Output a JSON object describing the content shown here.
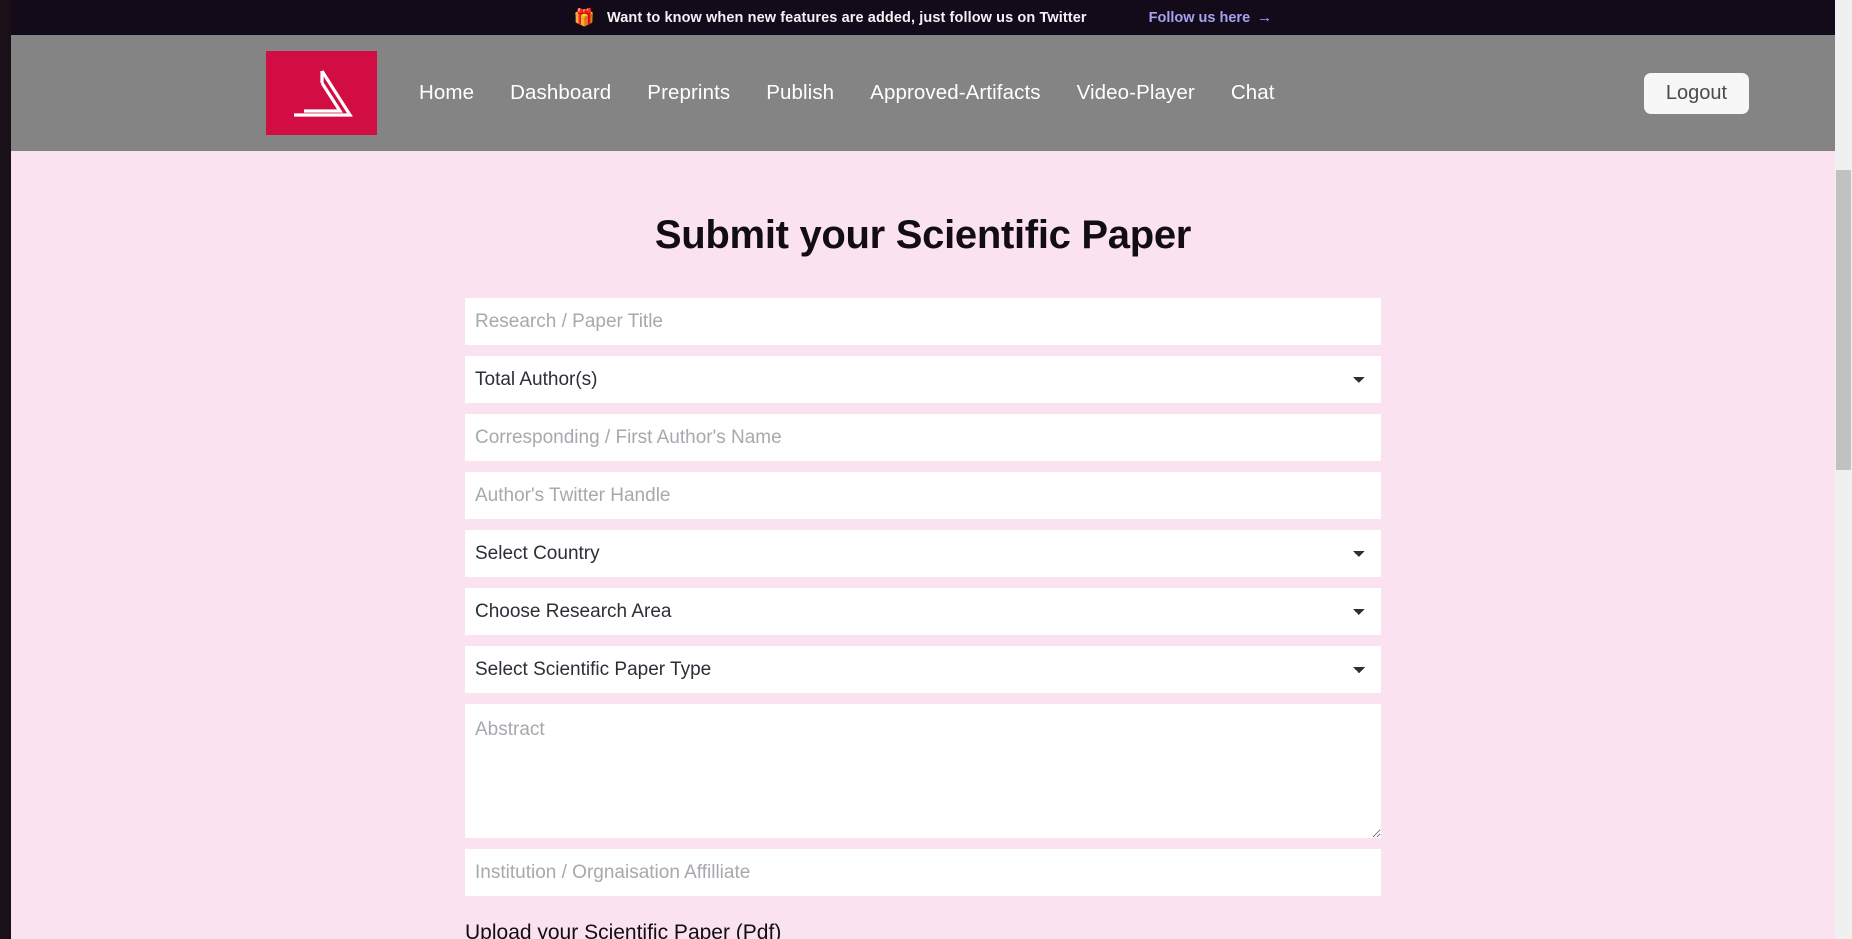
{
  "banner": {
    "icon": "gift-icon",
    "text": "Want to know when new features are added, just follow us on Twitter",
    "link_label": "Follow us here",
    "link_arrow": "→",
    "background": "#140b1a",
    "link_color": "#a6a1f0"
  },
  "navbar": {
    "logo_name": "triangle-spiral-logo",
    "logo_color": "#D10D43",
    "background": "#848484",
    "links": [
      {
        "label": "Home"
      },
      {
        "label": "Dashboard"
      },
      {
        "label": "Preprints"
      },
      {
        "label": "Publish"
      },
      {
        "label": "Approved-Artifacts"
      },
      {
        "label": "Video-Player"
      },
      {
        "label": "Chat"
      }
    ],
    "logout_label": "Logout"
  },
  "page": {
    "title": "Submit your Scientific Paper",
    "background": "#FBE2F0",
    "title_color": "#120d14"
  },
  "form": {
    "paper_title": {
      "placeholder": "Research / Paper Title",
      "value": ""
    },
    "total_authors": {
      "selected": "Total Author(s)"
    },
    "first_author": {
      "placeholder": "Corresponding / First Author's Name",
      "value": ""
    },
    "twitter_handle": {
      "placeholder": "Author's Twitter Handle",
      "value": ""
    },
    "country": {
      "selected": "Select Country"
    },
    "research_area": {
      "selected": "Choose Research Area"
    },
    "paper_type": {
      "selected": "Select Scientific Paper Type"
    },
    "abstract": {
      "placeholder": "Abstract",
      "value": ""
    },
    "institution": {
      "placeholder": "Institution / Orgnaisation Affilliate",
      "value": ""
    },
    "upload_label": "Upload your Scientific Paper (Pdf)"
  }
}
